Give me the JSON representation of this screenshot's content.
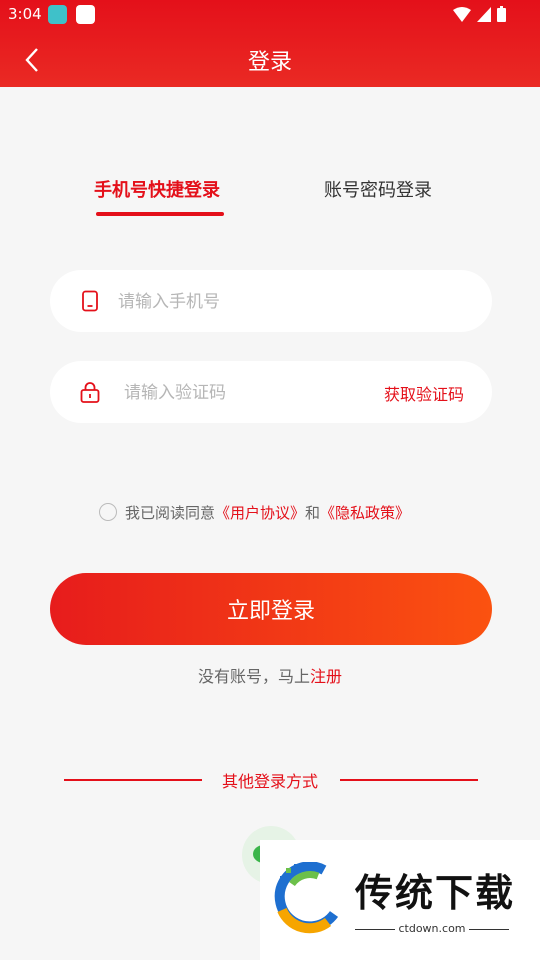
{
  "status_bar": {
    "time": "3:04"
  },
  "header": {
    "title": "登录"
  },
  "tabs": {
    "active": "手机号快捷登录",
    "inactive": "账号密码登录"
  },
  "phone_field": {
    "placeholder": "请输入手机号"
  },
  "code_field": {
    "placeholder": "请输入验证码",
    "get_code": "获取验证码"
  },
  "agreement": {
    "prefix": "我已阅读同意",
    "user_agreement": "《用户协议》",
    "and": "和",
    "privacy": "《隐私政策》"
  },
  "login_button": {
    "label": "立即登录"
  },
  "register": {
    "prefix": "没有账号，马上",
    "link": "注册"
  },
  "other_login": {
    "label": "其他登录方式"
  },
  "watermark": {
    "title": "传统下载",
    "domain": "ctdown.com"
  },
  "colors": {
    "brand_red": "#e4101a",
    "button_gradient_end": "#fb5210"
  }
}
